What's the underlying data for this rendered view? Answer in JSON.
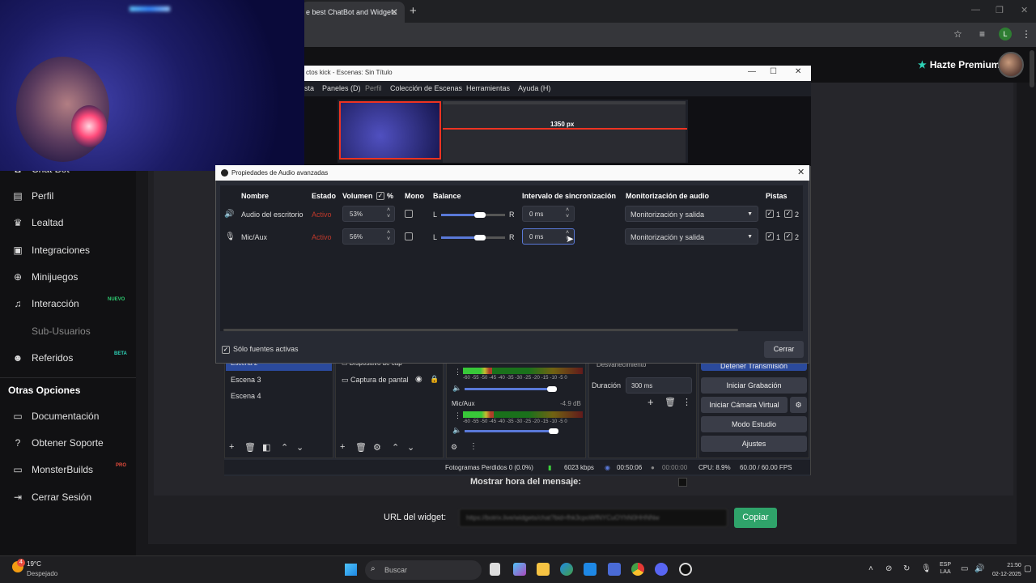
{
  "browser": {
    "tab_title": "e best ChatBot and Widgets",
    "tab_close": "✕",
    "new_tab": "+",
    "profile_initial": "L"
  },
  "site": {
    "premium_label": "Hazte Premium",
    "sidebar": {
      "items": [
        {
          "label": "Chat Bot",
          "icon": "robot-icon"
        },
        {
          "label": "Perfil",
          "icon": "id-card-icon"
        },
        {
          "label": "Lealtad",
          "icon": "trophy-icon"
        },
        {
          "label": "Integraciones",
          "icon": "puzzle-icon"
        },
        {
          "label": "Minijuegos",
          "icon": "gamepad-icon"
        },
        {
          "label": "Interacción",
          "icon": "music-note-icon",
          "badge": "NUEVO"
        },
        {
          "label": "Sub-Usuarios",
          "icon": "users-icon"
        },
        {
          "label": "Referidos",
          "icon": "referral-icon",
          "badge": "BETA"
        }
      ],
      "other_title": "Otras Opciones",
      "other_items": [
        {
          "label": "Documentación",
          "icon": "book-icon"
        },
        {
          "label": "Obtener Soporte",
          "icon": "help-icon"
        },
        {
          "label": "MonsterBuilds",
          "icon": "monitor-icon",
          "badge": "PRO"
        },
        {
          "label": "Cerrar Sesión",
          "icon": "logout-icon"
        }
      ]
    },
    "message_time_label": "Mostrar hora del mensaje:",
    "widget_url_label": "URL del widget:",
    "widget_url_value": "https://botrix.live/widgets/chat?bid=fhk3cpoWfNYCuOYhN0HHNNw",
    "copy_button": "Copiar",
    "colors": {
      "accent": "#2ed3b7",
      "copy": "#2fa36a"
    }
  },
  "obs": {
    "title": "ctos kick - Escenas: Sin Título",
    "menu": [
      "sta",
      "Paneles (D)",
      "Perfil",
      "Colección de Escenas",
      "Herramientas",
      "Ayuda (H)"
    ],
    "preview_label": "1350 px",
    "scenes": [
      "Escena 2",
      "Escena 3",
      "Escena 4"
    ],
    "sources": [
      "Dispositivo de cap",
      "Captura de pantal"
    ],
    "mixer": {
      "meter_scale": "-60 -55 -50 -45 -40 -35 -30 -25 -20 -15 -10 -5 0",
      "mic_label": "Mic/Aux",
      "mic_db": "-4.9 dB"
    },
    "transition": {
      "type": "Desvanecimiento",
      "duration_label": "Duración",
      "duration_value": "300 ms"
    },
    "controls": [
      "Detener Transmisión",
      "Iniciar Grabación",
      "Iniciar Cámara Virtual",
      "Modo Estudio",
      "Ajustes"
    ],
    "status": {
      "dropped": "Fotogramas Perdidos 0 (0.0%)",
      "bitrate": "6023 kbps",
      "live_time": "00:50:06",
      "rec_time": "00:00:00",
      "cpu": "CPU: 8.9%",
      "fps": "60.00 / 60.00 FPS"
    }
  },
  "dialog": {
    "title": "Propiedades de Audio avanzadas",
    "headers": {
      "name": "Nombre",
      "status": "Estado",
      "volume": "Volumen",
      "percent": "%",
      "mono": "Mono",
      "balance": "Balance",
      "sync": "Intervalo de sincronización",
      "monitor": "Monitorización de audio",
      "tracks": "Pistas"
    },
    "rows": [
      {
        "name": "Audio del escritorio",
        "status": "Activo",
        "volume": "53%",
        "balance_left": "L",
        "balance_right": "R",
        "balance": 0.5,
        "sync": "0 ms",
        "monitor": "Monitorización y salida",
        "track1": "1",
        "track2": "2"
      },
      {
        "name": "Mic/Aux",
        "status": "Activo",
        "volume": "56%",
        "balance_left": "L",
        "balance_right": "R",
        "balance": 0.5,
        "sync": "0 ms",
        "monitor": "Monitorización y salida",
        "track1": "1",
        "track2": "2"
      }
    ],
    "only_active_label": "Sólo fuentes activas",
    "close_button": "Cerrar"
  },
  "taskbar": {
    "weather_temp": "19°C",
    "weather_desc": "Despejado",
    "weather_badge": "4",
    "search_placeholder": "Buscar",
    "lang_top": "ESP",
    "lang_bottom": "LAA",
    "time": "21:50",
    "date": "02-12-2025"
  }
}
